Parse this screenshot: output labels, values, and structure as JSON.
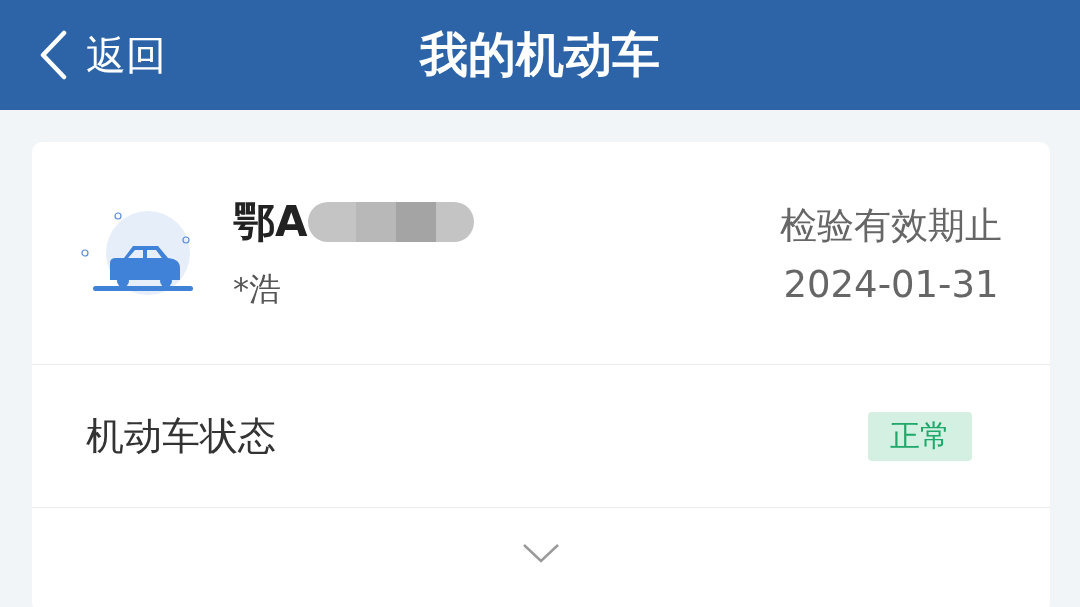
{
  "header": {
    "back_label": "返回",
    "title": "我的机动车"
  },
  "vehicle": {
    "plate": "鄂A",
    "owner": "*浩",
    "expiry_label": "检验有效期止",
    "expiry_date": "2024-01-31"
  },
  "status_row": {
    "label": "机动车状态",
    "badge": "正常"
  },
  "expand": {
    "expanded": false
  }
}
